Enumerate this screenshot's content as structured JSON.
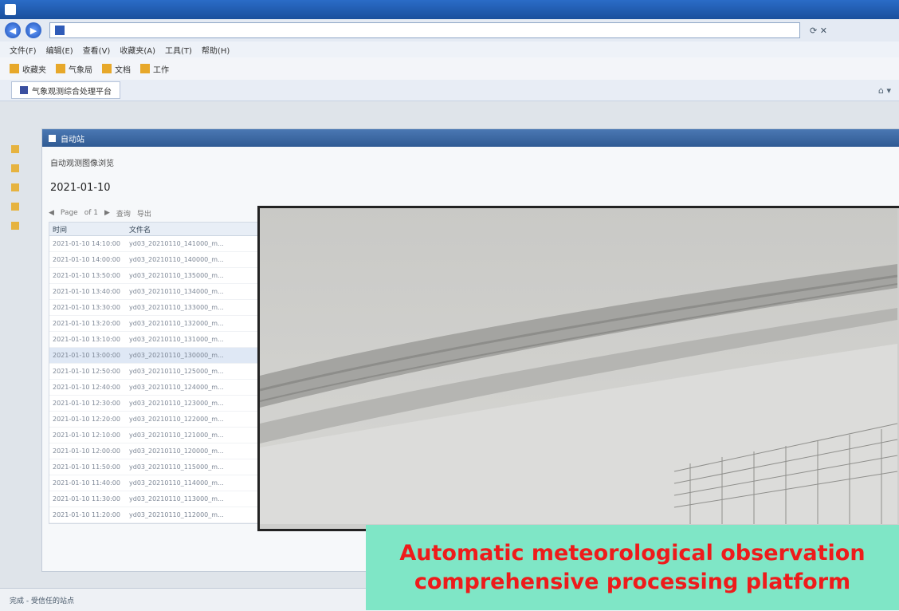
{
  "browser": {
    "title": "",
    "url": "",
    "menu": [
      "文件(F)",
      "编辑(E)",
      "查看(V)",
      "收藏夹(A)",
      "工具(T)",
      "帮助(H)"
    ],
    "favorites": [
      "收藏夹",
      "气象局",
      "文档",
      "工作"
    ],
    "tab_label": "气象观测综合处理平台"
  },
  "panel": {
    "header": "自动站",
    "breadcrumb": "自动观测图像浏览",
    "date": "2021-01-10",
    "toolbar": [
      "Page",
      "of 1",
      "查询",
      "导出"
    ],
    "columns": [
      "时间",
      "文件名"
    ],
    "rows": [
      {
        "time": "2021-01-10 14:10:00",
        "file": "yd03_20210110_141000_m..."
      },
      {
        "time": "2021-01-10 14:00:00",
        "file": "yd03_20210110_140000_m..."
      },
      {
        "time": "2021-01-10 13:50:00",
        "file": "yd03_20210110_135000_m..."
      },
      {
        "time": "2021-01-10 13:40:00",
        "file": "yd03_20210110_134000_m..."
      },
      {
        "time": "2021-01-10 13:30:00",
        "file": "yd03_20210110_133000_m..."
      },
      {
        "time": "2021-01-10 13:20:00",
        "file": "yd03_20210110_132000_m..."
      },
      {
        "time": "2021-01-10 13:10:00",
        "file": "yd03_20210110_131000_m..."
      },
      {
        "time": "2021-01-10 13:00:00",
        "file": "yd03_20210110_130000_m..."
      },
      {
        "time": "2021-01-10 12:50:00",
        "file": "yd03_20210110_125000_m..."
      },
      {
        "time": "2021-01-10 12:40:00",
        "file": "yd03_20210110_124000_m..."
      },
      {
        "time": "2021-01-10 12:30:00",
        "file": "yd03_20210110_123000_m..."
      },
      {
        "time": "2021-01-10 12:20:00",
        "file": "yd03_20210110_122000_m..."
      },
      {
        "time": "2021-01-10 12:10:00",
        "file": "yd03_20210110_121000_m..."
      },
      {
        "time": "2021-01-10 12:00:00",
        "file": "yd03_20210110_120000_m..."
      },
      {
        "time": "2021-01-10 11:50:00",
        "file": "yd03_20210110_115000_m..."
      },
      {
        "time": "2021-01-10 11:40:00",
        "file": "yd03_20210110_114000_m..."
      },
      {
        "time": "2021-01-10 11:30:00",
        "file": "yd03_20210110_113000_m..."
      },
      {
        "time": "2021-01-10 11:20:00",
        "file": "yd03_20210110_112000_m..."
      }
    ],
    "selected_row": 7
  },
  "status": "完成 - 受信任的站点",
  "caption": {
    "line1": "Automatic meteorological observation",
    "line2": "comprehensive processing platform"
  }
}
